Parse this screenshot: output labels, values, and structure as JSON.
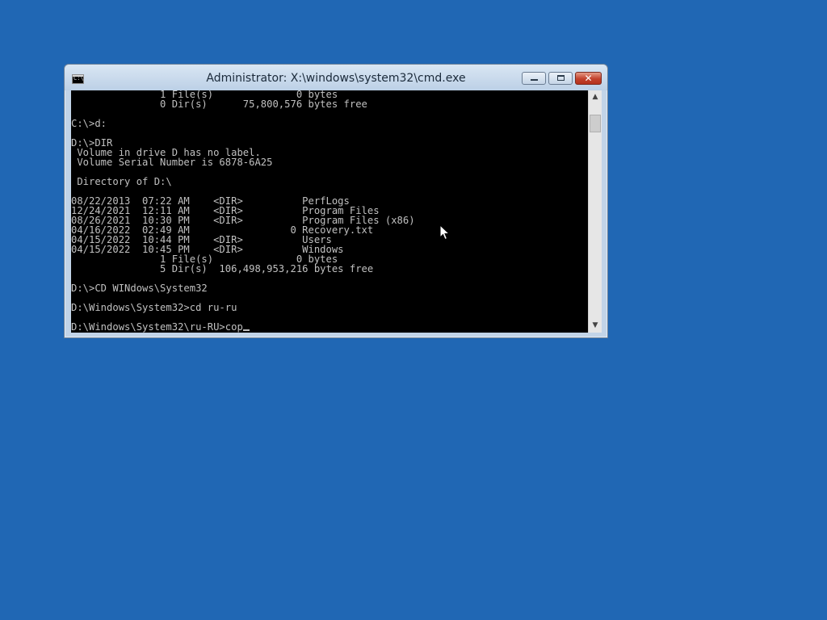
{
  "window": {
    "title": "Administrator: X:\\windows\\system32\\cmd.exe",
    "icon": "cmd-app-icon",
    "icon_glyph": "C:\\",
    "controls": {
      "minimize": "minimize-icon",
      "maximize": "maximize-icon",
      "close_glyph": "✕"
    }
  },
  "console": {
    "lines": [
      "               1 File(s)              0 bytes",
      "               0 Dir(s)      75,800,576 bytes free",
      "",
      "C:\\>d:",
      "",
      "D:\\>DIR",
      " Volume in drive D has no label.",
      " Volume Serial Number is 6878-6A25",
      "",
      " Directory of D:\\",
      "",
      "08/22/2013  07:22 AM    <DIR>          PerfLogs",
      "12/24/2021  12:11 AM    <DIR>          Program Files",
      "08/26/2021  10:30 PM    <DIR>          Program Files (x86)",
      "04/16/2022  02:49 AM                 0 Recovery.txt",
      "04/15/2022  10:44 PM    <DIR>          Users",
      "04/15/2022  10:45 PM    <DIR>          Windows",
      "               1 File(s)              0 bytes",
      "               5 Dir(s)  106,498,953,216 bytes free",
      "",
      "D:\\>CD WINdows\\System32",
      "",
      "D:\\Windows\\System32>cd ru-ru",
      ""
    ],
    "prompt": "D:\\Windows\\System32\\ru-RU>",
    "typed_input": "cop"
  },
  "scrollbar": {
    "up_arrow": "▲",
    "down_arrow": "▼"
  },
  "colors": {
    "desktop": "#2067b4",
    "console_bg": "#000000",
    "console_text": "#c0c0c0"
  }
}
